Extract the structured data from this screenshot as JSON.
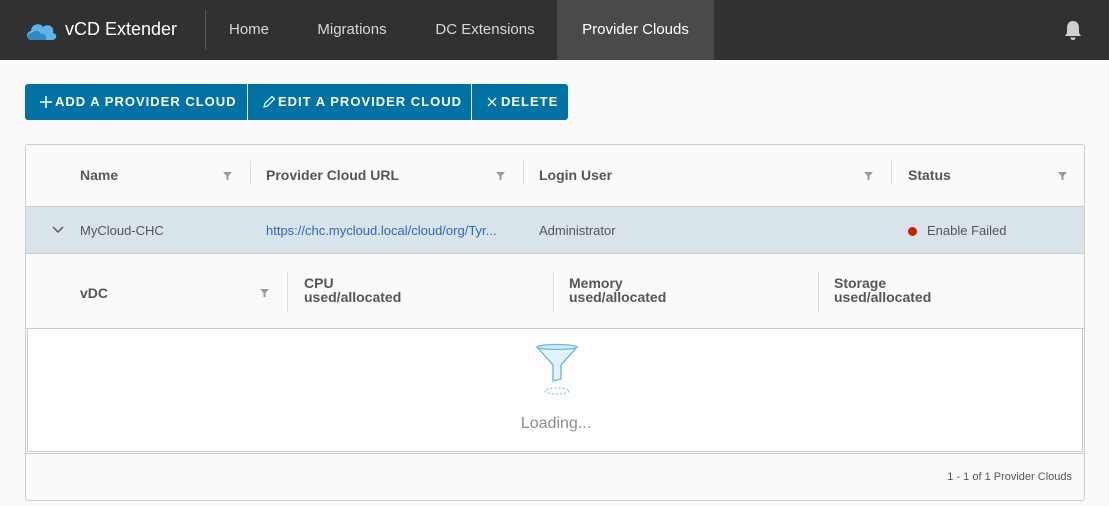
{
  "app": {
    "title": "vCD Extender",
    "logo_icon": "cloud-logo-icon"
  },
  "nav": {
    "items": [
      {
        "label": "Home",
        "active": false
      },
      {
        "label": "Migrations",
        "active": false
      },
      {
        "label": "DC Extensions",
        "active": false
      },
      {
        "label": "Provider Clouds",
        "active": true
      }
    ],
    "notification_icon": "bell-icon"
  },
  "toolbar": {
    "add_label": "ADD A PROVIDER CLOUD",
    "edit_label": "EDIT A PROVIDER CLOUD",
    "delete_label": "DELETE"
  },
  "grid": {
    "columns": [
      "Name",
      "Provider Cloud URL",
      "Login User",
      "Status"
    ],
    "rows": [
      {
        "name": "MyCloud-CHC",
        "url": "https://chc.mycloud.local/cloud/org/Tyr...",
        "login_user": "Administrator",
        "status": "Enable Failed",
        "status_color": "#c92100",
        "expanded": true
      }
    ],
    "detail": {
      "columns": {
        "vdc": "vDC",
        "cpu_line1": "CPU",
        "cpu_line2": "used/allocated",
        "memory_line1": "Memory",
        "memory_line2": "used/allocated",
        "storage_line1": "Storage",
        "storage_line2": "used/allocated"
      },
      "loading_text": "Loading..."
    },
    "footer": "1 - 1 of 1 Provider Clouds"
  },
  "colors": {
    "header_bg": "#313131",
    "accent": "#0072a3",
    "selected_row": "#d9e4ea"
  }
}
